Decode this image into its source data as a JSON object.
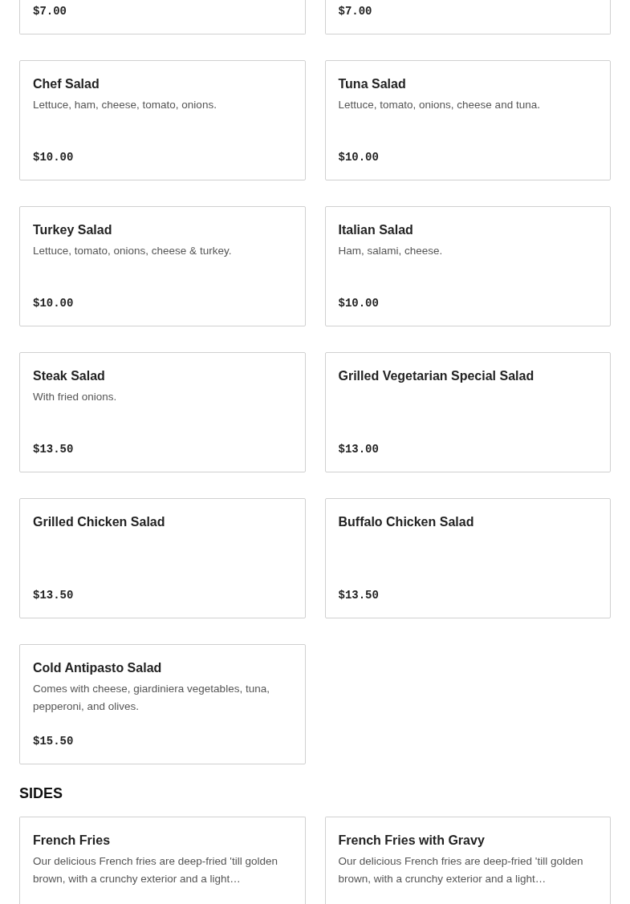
{
  "sections": [
    {
      "items": [
        {
          "kind": "cut-top",
          "price": "$7.00"
        },
        {
          "kind": "cut-top",
          "price": "$7.00"
        },
        {
          "kind": "full",
          "name": "Chef Salad",
          "description": "Lettuce, ham, cheese, tomato, onions.",
          "price": "$10.00"
        },
        {
          "kind": "full",
          "name": "Tuna Salad",
          "description": "Lettuce, tomato, onions, cheese and tuna.",
          "price": "$10.00"
        },
        {
          "kind": "full",
          "name": "Turkey Salad",
          "description": "Lettuce, tomato, onions, cheese & turkey.",
          "price": "$10.00"
        },
        {
          "kind": "full",
          "name": "Italian Salad",
          "description": "Ham, salami, cheese.",
          "price": "$10.00"
        },
        {
          "kind": "full",
          "name": "Steak Salad",
          "description": "With fried onions.",
          "price": "$13.50"
        },
        {
          "kind": "full",
          "name": "Grilled Vegetarian Special Salad",
          "price": "$13.00"
        },
        {
          "kind": "full",
          "name": "Grilled Chicken Salad",
          "price": "$13.50"
        },
        {
          "kind": "full",
          "name": "Buffalo Chicken Salad",
          "price": "$13.50"
        },
        {
          "kind": "full",
          "name": "Cold Antipasto Salad",
          "description": "Comes with cheese, giardiniera vegetables, tuna, pepperoni, and olives.",
          "price": "$15.50"
        }
      ]
    },
    {
      "title": "SIDES",
      "items": [
        {
          "kind": "cut-bottom",
          "name": "French Fries",
          "description": "Our delicious French fries are deep-fried 'till golden brown, with a crunchy exterior and a light…"
        },
        {
          "kind": "cut-bottom",
          "name": "French Fries with Gravy",
          "description": "Our delicious French fries are deep-fried 'till golden brown, with a crunchy exterior and a light…"
        }
      ]
    }
  ]
}
